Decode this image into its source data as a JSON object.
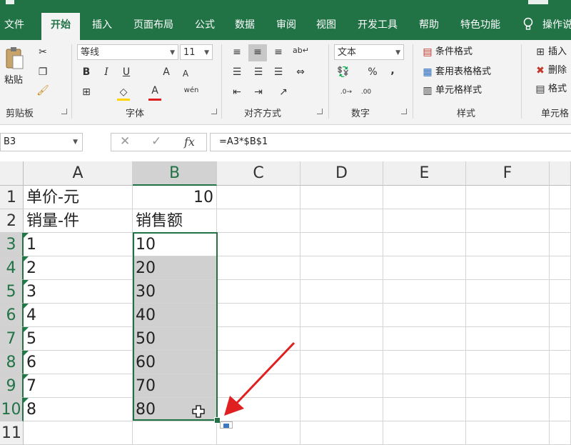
{
  "menu": {
    "tabs": [
      "文件",
      "开始",
      "插入",
      "页面布局",
      "公式",
      "数据",
      "审阅",
      "视图",
      "开发工具",
      "帮助",
      "特色功能"
    ],
    "active_tab": "开始",
    "tell_me": "操作说"
  },
  "ribbon": {
    "clipboard": {
      "paste": "粘贴",
      "label": "剪贴板"
    },
    "font": {
      "name": "等线",
      "size": "11",
      "bold": "B",
      "italic": "I",
      "underline": "U",
      "grow": "A",
      "shrink": "A",
      "color_letter": "A",
      "wen": "wén",
      "label": "字体"
    },
    "alignment": {
      "label": "对齐方式"
    },
    "number": {
      "format": "文本",
      "percent": "%",
      "comma": ",",
      "label": "数字"
    },
    "styles": {
      "conditional": "条件格式",
      "table": "套用表格格式",
      "cell_styles": "单元格样式",
      "label": "样式"
    },
    "cells": {
      "insert": "插入",
      "delete": "删除",
      "format": "格式",
      "label": "单元格"
    }
  },
  "formula_bar": {
    "name_box": "B3",
    "fx": "fx",
    "formula": "=A3*$B$1"
  },
  "grid": {
    "columns": [
      "A",
      "B",
      "C",
      "D",
      "E",
      "F"
    ],
    "rows": [
      "1",
      "2",
      "3",
      "4",
      "5",
      "6",
      "7",
      "8",
      "9",
      "10",
      "11"
    ],
    "cells": {
      "A1": "单价-元",
      "B1": "10",
      "A2": "销量-件",
      "B2": "销售额",
      "A3": "1",
      "B3": "10",
      "A4": "2",
      "B4": "20",
      "A5": "3",
      "B5": "30",
      "A6": "4",
      "B6": "40",
      "A7": "5",
      "B7": "50",
      "A8": "6",
      "B8": "60",
      "A9": "7",
      "B9": "70",
      "A10": "8",
      "B10": "80"
    },
    "selected_range": "B3:B10"
  },
  "colors": {
    "excel_green": "#217346",
    "arrow_red": "#e02020",
    "selection_fill": "#d0d0d0"
  }
}
